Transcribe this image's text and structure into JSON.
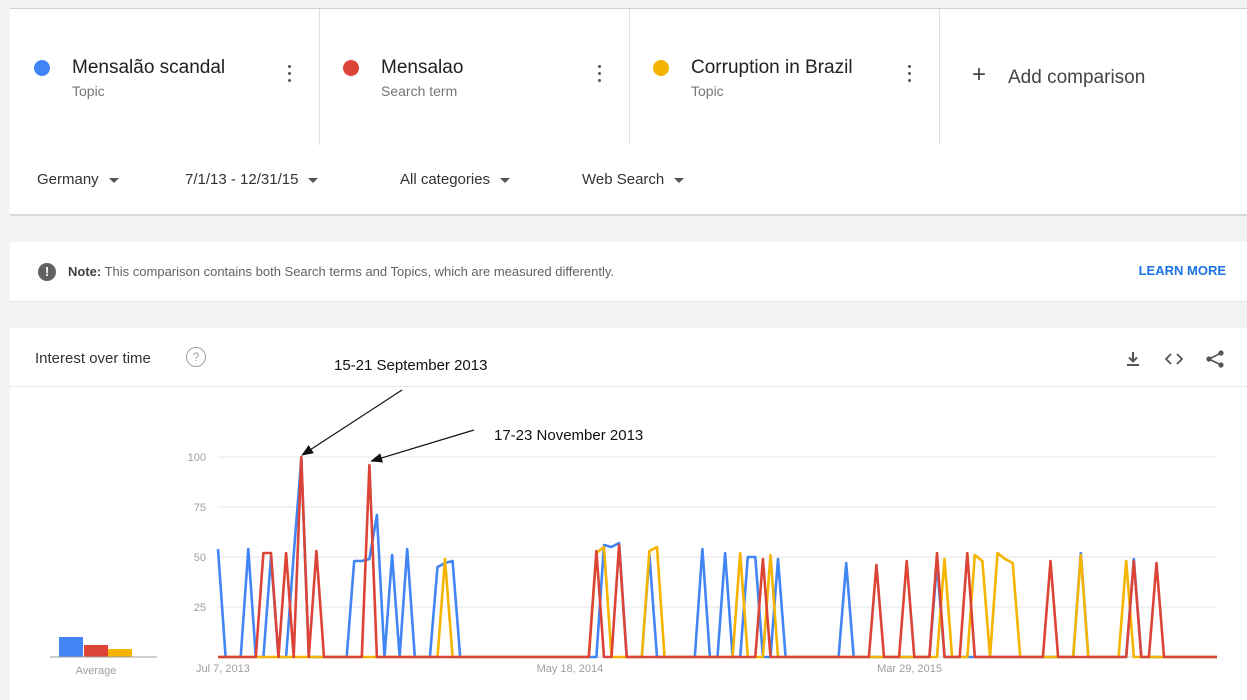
{
  "terms": [
    {
      "name": "Mensalão scandal",
      "kind": "Topic",
      "color": "#4285f4"
    },
    {
      "name": "Mensalao",
      "kind": "Search term",
      "color": "#db4437"
    },
    {
      "name": "Corruption in Brazil",
      "kind": "Topic",
      "color": "#f4b400"
    }
  ],
  "add_comparison": "Add comparison",
  "filters": {
    "region": "Germany",
    "time_range": "7/1/13 - 12/31/15",
    "category": "All categories",
    "search_type": "Web Search"
  },
  "note": {
    "prefix": "Note:",
    "text": "This comparison contains both Search terms and Topics, which are measured differently.",
    "link": "LEARN MORE"
  },
  "chart_panel": {
    "title": "Interest over time",
    "help_icon": "help-circle-icon",
    "tools": [
      "download-icon",
      "embed-code-icon",
      "share-icon"
    ]
  },
  "annotations": [
    {
      "text": "15-21 September 2013",
      "points_to_week": 11,
      "series": "Mensalao"
    },
    {
      "text": "17-23 November 2013",
      "points_to_week": 20,
      "series": "Mensalao"
    }
  ],
  "chart_data": {
    "type": "line",
    "x_start": "2013-07-07",
    "x_tick_labels": [
      {
        "label": "Jul 7, 2013",
        "week": 0
      },
      {
        "label": "May 18, 2014",
        "week": 45
      },
      {
        "label": "Mar 29, 2015",
        "week": 90
      }
    ],
    "y_ticks": [
      25,
      50,
      75,
      100
    ],
    "ylim": [
      0,
      100
    ],
    "average_label": "Average",
    "averages": [
      10,
      6,
      4
    ],
    "series": [
      {
        "name": "Mensalão scandal",
        "color": "#4285f4",
        "spikes": [
          [
            0,
            54
          ],
          [
            4,
            54
          ],
          [
            7,
            50
          ],
          [
            10,
            51
          ],
          [
            11,
            99
          ],
          [
            18,
            48
          ],
          [
            19,
            48
          ],
          [
            20,
            49
          ],
          [
            21,
            71
          ],
          [
            23,
            51
          ],
          [
            25,
            54
          ],
          [
            29,
            45
          ],
          [
            30,
            47
          ],
          [
            31,
            48
          ],
          [
            51,
            56
          ],
          [
            52,
            55
          ],
          [
            53,
            57
          ],
          [
            57,
            51
          ],
          [
            64,
            54
          ],
          [
            67,
            52
          ],
          [
            70,
            50
          ],
          [
            71,
            50
          ],
          [
            74,
            49
          ],
          [
            83,
            47
          ],
          [
            95,
            47
          ],
          [
            114,
            52
          ],
          [
            121,
            49
          ]
        ]
      },
      {
        "name": "Mensalao",
        "color": "#db4437",
        "spikes": [
          [
            6,
            52
          ],
          [
            7,
            52
          ],
          [
            9,
            52
          ],
          [
            11,
            100
          ],
          [
            13,
            53
          ],
          [
            20,
            96
          ],
          [
            50,
            53
          ],
          [
            53,
            56
          ],
          [
            72,
            49
          ],
          [
            87,
            46
          ],
          [
            91,
            48
          ],
          [
            95,
            52
          ],
          [
            99,
            52
          ],
          [
            110,
            48
          ],
          [
            121,
            48
          ],
          [
            124,
            47
          ]
        ]
      },
      {
        "name": "Corruption in Brazil",
        "color": "#f4b400",
        "spikes": [
          [
            30,
            49
          ],
          [
            50,
            52
          ],
          [
            51,
            55
          ],
          [
            57,
            53
          ],
          [
            58,
            55
          ],
          [
            69,
            52
          ],
          [
            73,
            51
          ],
          [
            96,
            49
          ],
          [
            100,
            51
          ],
          [
            101,
            48
          ],
          [
            103,
            52
          ],
          [
            104,
            49
          ],
          [
            105,
            47
          ],
          [
            114,
            51
          ],
          [
            120,
            48
          ]
        ]
      }
    ],
    "total_weeks": 132
  }
}
